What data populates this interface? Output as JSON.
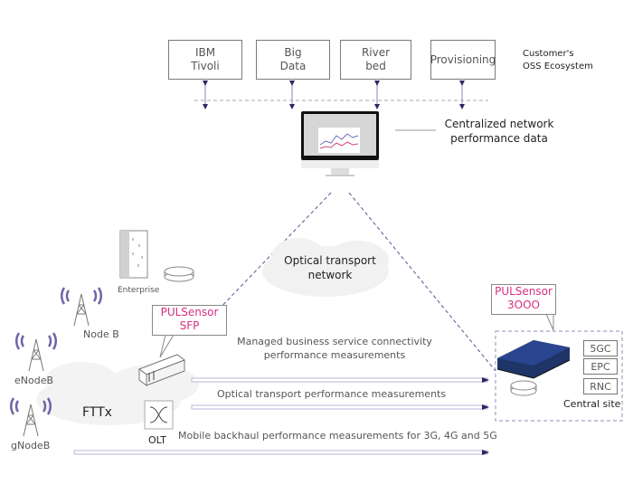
{
  "oss": {
    "boxes": [
      {
        "label": "IBM\nTivoli"
      },
      {
        "label": "Big\nData"
      },
      {
        "label": "River\nbed"
      },
      {
        "label": "Provisioning"
      }
    ],
    "ecosystem_label": "Customer's\nOSS Ecosystem"
  },
  "monitor": {
    "caption": "Centralized network\nperformance data"
  },
  "otn": {
    "label": "Optical transport\nnetwork"
  },
  "enterprise": {
    "label": "Enterprise"
  },
  "sfp": {
    "callout": "PULSensor\nSFP"
  },
  "pul3000": {
    "callout": "PULSensor\n3OOO"
  },
  "towers": [
    {
      "label": "Node B"
    },
    {
      "label": "eNodeB"
    },
    {
      "label": "gNodeB"
    }
  ],
  "fttx": {
    "label": "FTTx"
  },
  "olt": {
    "label": "OLT"
  },
  "measurements": [
    {
      "label": "Managed business service connectivity\nperformance measurements"
    },
    {
      "label": "Optical transport performance measurements"
    },
    {
      "label": "Mobile backhaul performance measurements for 3G, 4G and 5G"
    }
  ],
  "central_site": {
    "label": "Central site",
    "cores": [
      "5GC",
      "EPC",
      "RNC"
    ]
  },
  "colors": {
    "accent_pink": "#d6307f",
    "arrow": "#2e2560",
    "line": "#b9b5d8",
    "device_blue": "#1f3568"
  }
}
